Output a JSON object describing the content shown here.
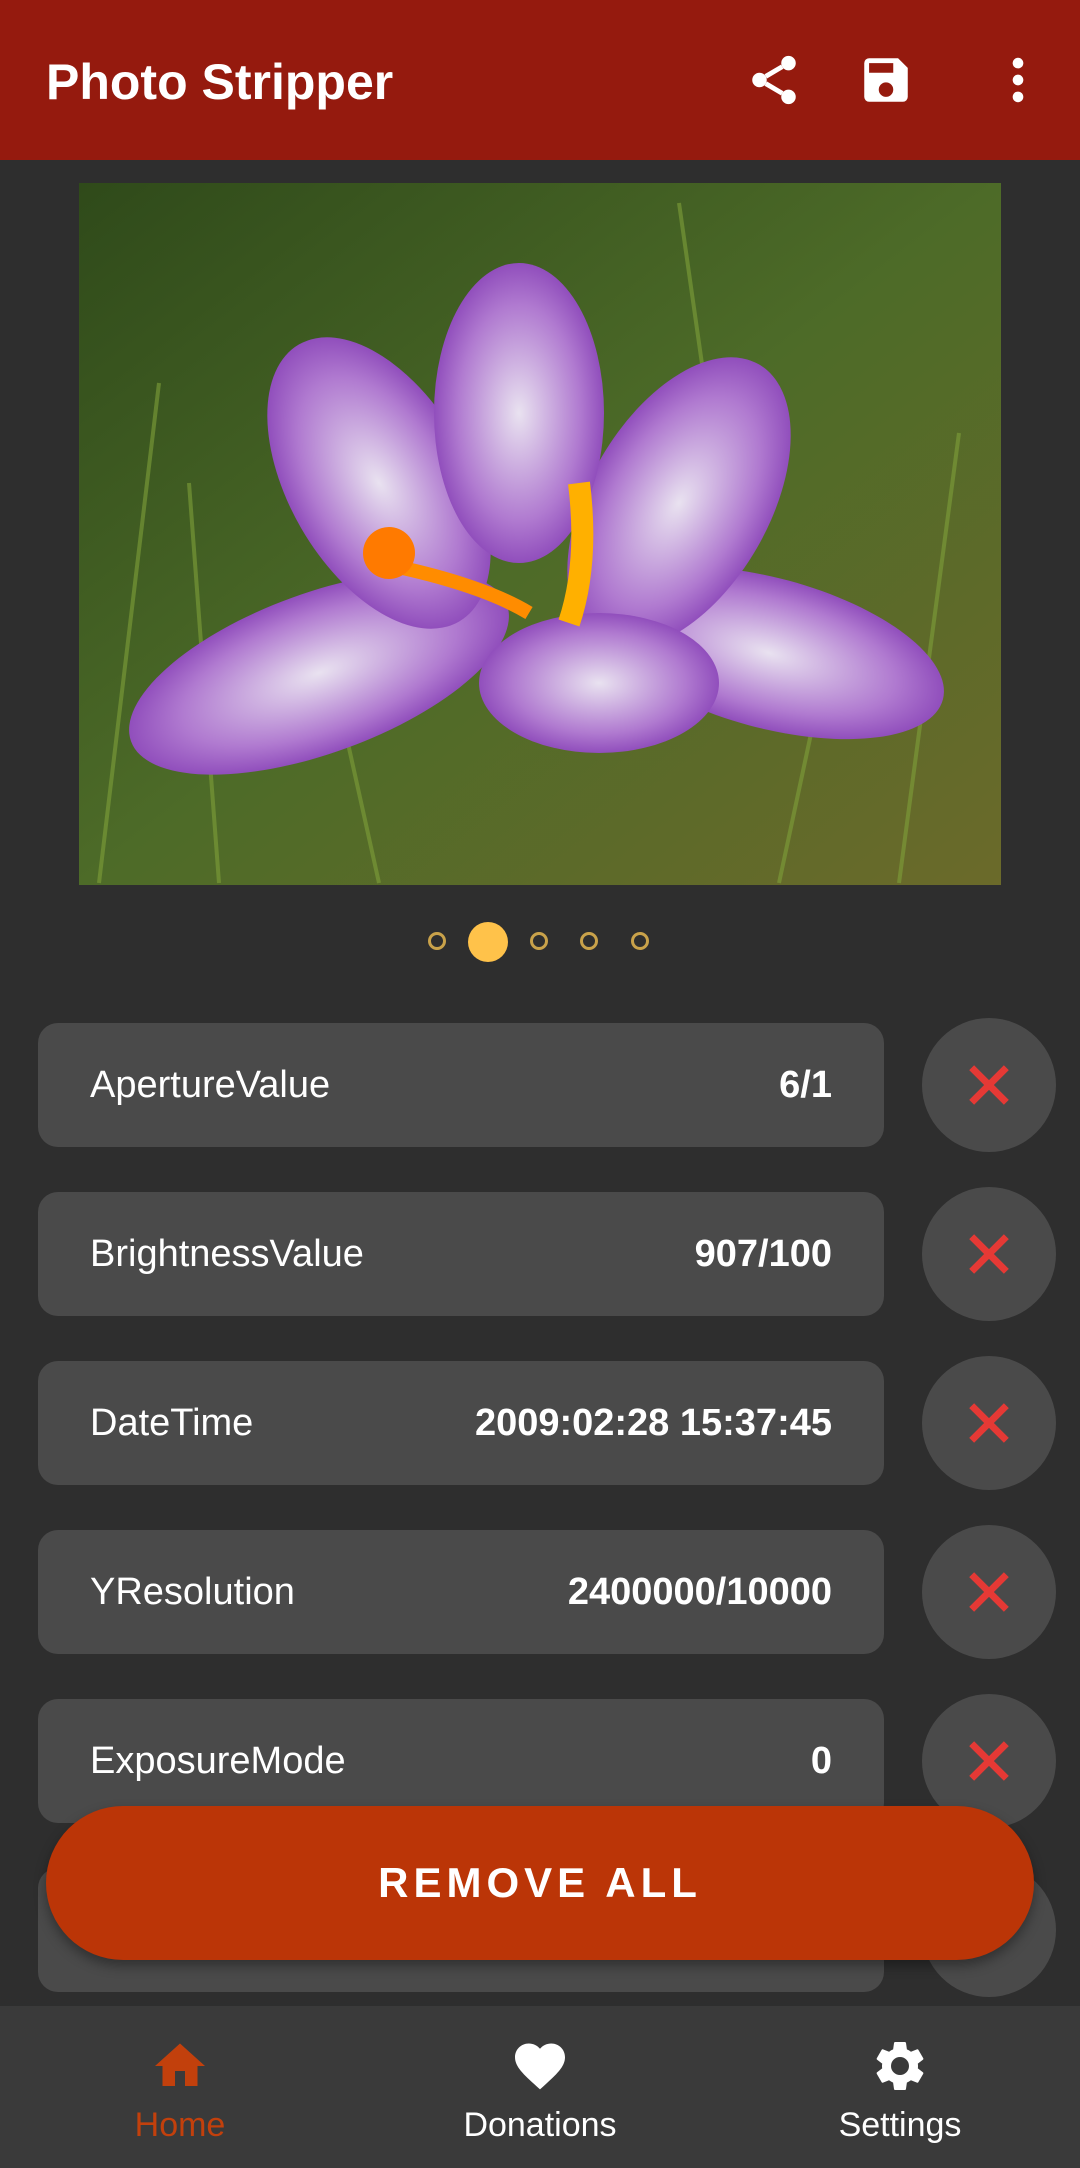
{
  "app": {
    "title": "Photo Stripper"
  },
  "colors": {
    "app_bar": "#951a0e",
    "background": "#2e2e2e",
    "row_bg": "#4a4a4a",
    "accent_dot": "#ffc24a",
    "delete_icon": "#e53935",
    "remove_all_button": "#bb3507",
    "nav_active": "#c2400c"
  },
  "toolbar": {
    "share_icon": "share-icon",
    "save_icon": "save-icon",
    "more_icon": "more-vert-icon"
  },
  "pager": {
    "count": 5,
    "active_index": 1
  },
  "metadata": [
    {
      "key": "ApertureValue",
      "value": "6/1"
    },
    {
      "key": "BrightnessValue",
      "value": "907/100"
    },
    {
      "key": "DateTime",
      "value": "2009:02:28 15:37:45"
    },
    {
      "key": "YResolution",
      "value": "2400000/10000"
    },
    {
      "key": "ExposureMode",
      "value": "0"
    }
  ],
  "actions": {
    "remove_all_label": "REMOVE ALL"
  },
  "bottom_nav": {
    "items": [
      {
        "label": "Home",
        "icon": "home-icon",
        "active": true
      },
      {
        "label": "Donations",
        "icon": "heart-icon",
        "active": false
      },
      {
        "label": "Settings",
        "icon": "gear-icon",
        "active": false
      }
    ]
  }
}
